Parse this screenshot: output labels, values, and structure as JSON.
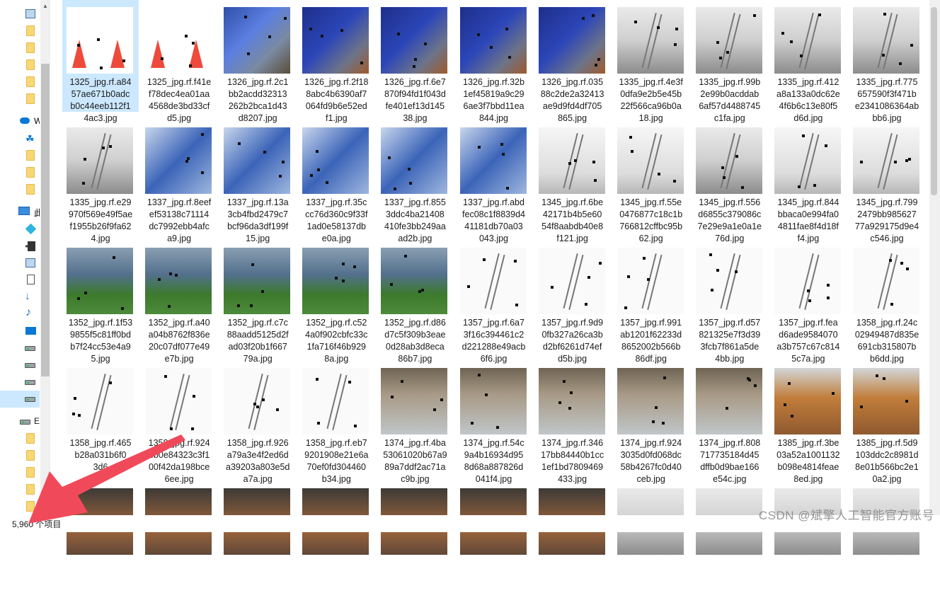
{
  "nav": {
    "cloud_label": "W",
    "pc_label": "此",
    "drive_e_label": "E"
  },
  "files": [
    [
      "1325_jpg.rf.a84\n57ae671b0adc\nb0c44eeb112f1\n4ac3.jpg",
      "th-cone"
    ],
    [
      "1325_jpg.rf.f41e\nf78dec4ea01aa\n4568de3bd33cf\nd5.jpg",
      "th-cone"
    ],
    [
      "1326_jpg.rf.2c1\nbb2acdd32313\n262b2bca1d43\nd8207.jpg",
      "th-plane"
    ],
    [
      "1326_jpg.rf.2f18\n8abc4b6390af7\n064fd9b6e52ed\nf1.jpg",
      "th-plane2"
    ],
    [
      "1326_jpg.rf.6e7\n870f94fd1f043d\nfe401ef13d145\n38.jpg",
      "th-plane2"
    ],
    [
      "1326_jpg.rf.32b\n1ef45819a9c29\n6ae3f7bbd11ea\n844.jpg",
      "th-plane2"
    ],
    [
      "1326_jpg.rf.035\n88c2de2a32413\nae9d9fd4df705\n865.jpg",
      "th-plane2"
    ],
    [
      "1335_jpg.rf.4e3f\n0dfa9e2b5e45b\n22f566ca96b0a\n18.jpg",
      "th-bw"
    ],
    [
      "1335_jpg.rf.99b\n2e99b0acddab\n6af57d4488745\nc1fa.jpg",
      "th-bw"
    ],
    [
      "1335_jpg.rf.412\na8a133a0dc62e\n4f6b6c13e80f5\nd6d.jpg",
      "th-bw"
    ],
    [
      "1335_jpg.rf.775\n657590f3f471b\ne2341086364ab\nbb6.jpg",
      "th-bw"
    ],
    [
      "1335_jpg.rf.e29\n970f569e49f5ae\nf1955b26f9fa62\n4.jpg",
      "th-bw"
    ],
    [
      "1337_jpg.rf.8eef\nef53138c71114\ndc7992ebb4afc\na9.jpg",
      "th-blue"
    ],
    [
      "1337_jpg.rf.13a\n3cb4fbd2479c7\nbcf96da3df199f\n15.jpg",
      "th-blue"
    ],
    [
      "1337_jpg.rf.35c\ncc76d360c9f33f\n1ad0e58137db\ne0a.jpg",
      "th-blue"
    ],
    [
      "1337_jpg.rf.855\n3ddc4ba21408\n410fe3bb249aa\nad2b.jpg",
      "th-blue"
    ],
    [
      "1337_jpg.rf.abd\nfec08c1f8839d4\n41181db70a03\n043.jpg",
      "th-blue"
    ],
    [
      "1345_jpg.rf.6be\n42171b4b5e60\n54f8aabdb40e8\nf121.jpg",
      "th-ladder"
    ],
    [
      "1345_jpg.rf.55e\n0476877c18c1b\n766812cffbc95b\n62.jpg",
      "th-ladder"
    ],
    [
      "1345_jpg.rf.556\nd6855c379086c\n7e29e9a1e0a1e\n76d.jpg",
      "th-bw"
    ],
    [
      "1345_jpg.rf.844\nbbaca0e994fa0\n4811fae8f4d18f\nf4.jpg",
      "th-ladder"
    ],
    [
      "1345_jpg.rf.799\n2479bb985627\n77a929175d9e4\nc546.jpg",
      "th-ladder"
    ],
    [
      "1352_jpg.rf.1f53\n9855f5c81ff0bd\nb7f24cc53e4a9\n5.jpg",
      "th-grass"
    ],
    [
      "1352_jpg.rf.a40\na04b8762f836e\n20c07df077e49\ne7b.jpg",
      "th-grass"
    ],
    [
      "1352_jpg.rf.c7c\n88aadd5125d2f\nad03f20b1f667\n79a.jpg",
      "th-grass"
    ],
    [
      "1352_jpg.rf.c52\n4a0f902cbfc33c\n1fa716f46b929\n8a.jpg",
      "th-grass"
    ],
    [
      "1352_jpg.rf.d86\nd7c5f309b3eae\n0d28ab3d8eca\n86b7.jpg",
      "th-grass"
    ],
    [
      "1357_jpg.rf.6a7\n3f16c394461c2\nd221288e49acb\n6f6.jpg",
      "th-white"
    ],
    [
      "1357_jpg.rf.9d9\n0fb327a26ca3b\nd2bf6261d74ef\nd5b.jpg",
      "th-white"
    ],
    [
      "1357_jpg.rf.991\nab1201f62233d\n8652002b566b\n86df.jpg",
      "th-white"
    ],
    [
      "1357_jpg.rf.d57\n821325e7f3d39\n3fcb7f861a5de\n4bb.jpg",
      "th-white"
    ],
    [
      "1357_jpg.rf.fea\nd6ade9584070\na3b757c67c814\n5c7a.jpg",
      "th-white"
    ],
    [
      "1358_jpg.rf.24c\n02949487d835e\n691cb315807b\nb6dd.jpg",
      "th-white"
    ],
    [
      "1358_jpg.rf.465\nb28a031b6f0\n3d6\n...",
      "th-white"
    ],
    [
      "1358_jpg.rf.924\neb0e84323c3f1\n00f42da198bce\n6ee.jpg",
      "th-white"
    ],
    [
      "1358_jpg.rf.926\na79a3e4f2ed6d\na39203a803e5d\na7a.jpg",
      "th-white"
    ],
    [
      "1358_jpg.rf.eb7\n9201908e21e6a\n70ef0fd304460\nb34.jpg",
      "th-white"
    ],
    [
      "1374_jpg.rf.4ba\n53061020b67a9\n89a7ddf2ac71a\nc9b.jpg",
      "th-site"
    ],
    [
      "1374_jpg.rf.54c\n9a4b16934d95\n8d68a887826d\n041f4.jpg",
      "th-site"
    ],
    [
      "1374_jpg.rf.346\n17bb84440b1cc\n1ef1bd7809469\n433.jpg",
      "th-site"
    ],
    [
      "1374_jpg.rf.924\n3035d0fd068dc\n58b4267fc0d40\nceb.jpg",
      "th-site"
    ],
    [
      "1374_jpg.rf.808\n717735184d45\ndffb0d9bae166\ne54c.jpg",
      "th-site"
    ],
    [
      "1385_jpg.rf.3be\n03a52a1001132\nb098e4814feae\n8ed.jpg",
      "th-build"
    ],
    [
      "1385_jpg.rf.5d9\n103ddc2c8981d\n8e01b566bc2e1\n0a2.jpg",
      "th-build"
    ]
  ],
  "status": {
    "count": "5,960 个项目",
    "watermark": "CSDN @斌擎人工智能官方账号"
  },
  "colors": {
    "selection": "#cce8ff",
    "arrow": "#f04a5a"
  }
}
